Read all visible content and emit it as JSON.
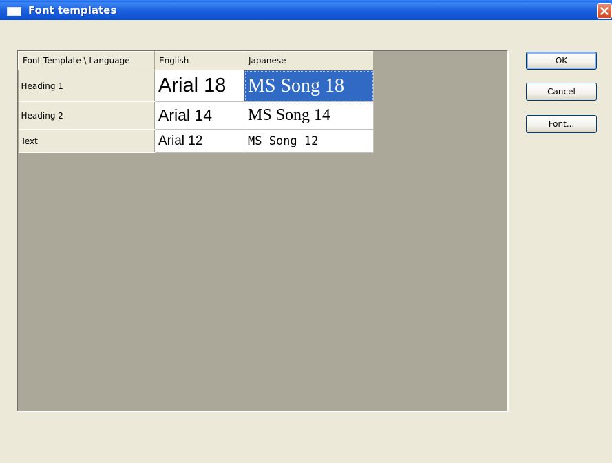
{
  "window": {
    "title": "Font templates"
  },
  "grid": {
    "columns": [
      "Font Template \\ Language",
      "English",
      "Japanese"
    ],
    "rows": [
      {
        "label": "Heading 1",
        "english": "Arial 18",
        "japanese": "MS Song 18"
      },
      {
        "label": "Heading 2",
        "english": "Arial 14",
        "japanese": "MS Song 14"
      },
      {
        "label": "Text",
        "english": "Arial 12",
        "japanese": "MS Song 12"
      }
    ],
    "selected_cell": "Heading 1 / Japanese"
  },
  "buttons": {
    "ok": "OK",
    "cancel": "Cancel",
    "font": "Font..."
  },
  "colors": {
    "titlebar": "#0a4fcf",
    "selection": "#316ac5",
    "dialog_bg": "#ece9d8",
    "grid_bg": "#aba899",
    "close_button": "#d44620"
  },
  "icons": {
    "window_icon": "window-icon",
    "close": "close-icon"
  }
}
